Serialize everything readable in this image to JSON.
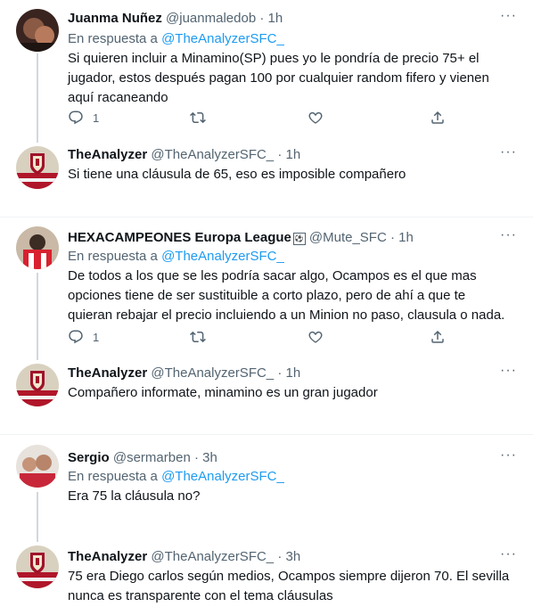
{
  "tweets": [
    {
      "name": "Juanma Nuñez",
      "handle": "@juanmaledob",
      "sep": "·",
      "time": "1h",
      "reply_prefix": "En respuesta a",
      "reply_to": "@TheAnalyzerSFC_",
      "text": "Si quieren incluir a Minamino(SP) pues yo le pondría de precio 75+ el jugador, estos después pagan 100 por cualquier random fifero y vienen aquí racaneando",
      "reply_count": "1"
    },
    {
      "name": "TheAnalyzer",
      "handle": "@TheAnalyzerSFC_",
      "sep": "·",
      "time": "1h",
      "text": "Si tiene una cláusula de 65, eso es imposible compañero"
    },
    {
      "name": "HEXACAMPEONES Europa League",
      "handle": "@Mute_SFC",
      "sep": "·",
      "time": "1h",
      "reply_prefix": "En respuesta a",
      "reply_to": "@TheAnalyzerSFC_",
      "text": "De todos a los que se les podría sacar algo, Ocampos es el que mas opciones tiene de ser sustituible a corto plazo, pero de ahí a que te quieran rebajar el precio incluiendo a un Minion no paso, clausula o nada.",
      "reply_count": "1"
    },
    {
      "name": "TheAnalyzer",
      "handle": "@TheAnalyzerSFC_",
      "sep": "·",
      "time": "1h",
      "text": "Compañero informate, minamino es un gran jugador"
    },
    {
      "name": "Sergio",
      "handle": "@sermarben",
      "sep": "·",
      "time": "3h",
      "reply_prefix": "En respuesta a",
      "reply_to": "@TheAnalyzerSFC_",
      "text": "Era 75 la cláusula no?"
    },
    {
      "name": "TheAnalyzer",
      "handle": "@TheAnalyzerSFC_",
      "sep": "·",
      "time": "3h",
      "text": "75 era Diego carlos según medios, Ocampos siempre dijeron 70. El sevilla nunca es transparente con el tema cláusulas"
    }
  ],
  "colors": {
    "text": "#0f1419",
    "secondary": "#536471",
    "link": "#1d9bf0",
    "divider": "#eff3f4",
    "thread_line": "#cfd9de"
  },
  "icons": [
    "reply-icon",
    "retweet-icon",
    "like-icon",
    "share-icon",
    "more-icon",
    "badge-icon"
  ]
}
